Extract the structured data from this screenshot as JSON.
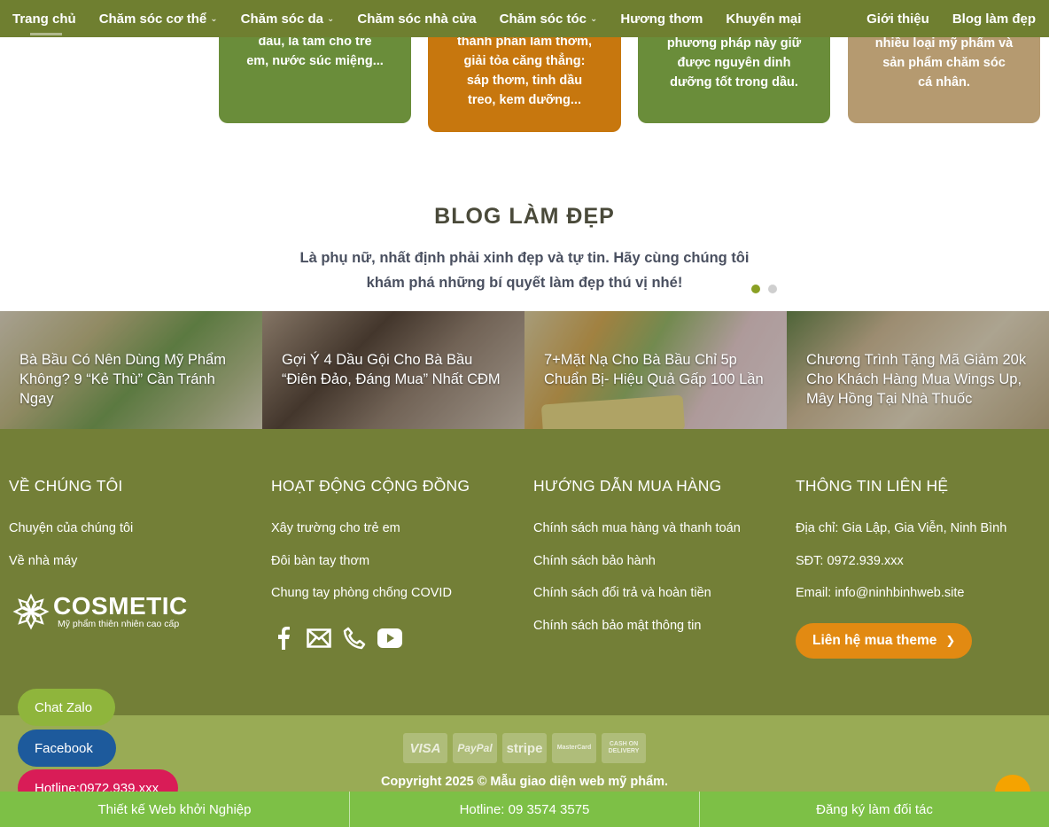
{
  "nav": {
    "items": [
      {
        "label": "Trang chủ",
        "dropdown": false,
        "active": true
      },
      {
        "label": "Chăm sóc cơ thể",
        "dropdown": true
      },
      {
        "label": "Chăm sóc da",
        "dropdown": true
      },
      {
        "label": "Chăm sóc nhà cửa",
        "dropdown": false
      },
      {
        "label": "Chăm sóc tóc",
        "dropdown": true
      },
      {
        "label": "Hương thơm",
        "dropdown": false
      },
      {
        "label": "Khuyến mại",
        "dropdown": false
      }
    ],
    "right_items": [
      {
        "label": "Giới thiệu"
      },
      {
        "label": "Blog làm đẹp"
      }
    ],
    "chevron": "⌄"
  },
  "cards": [
    {
      "lines": [
        "đầu, lá tắm cho trẻ",
        "em, nước súc miệng..."
      ],
      "color": "#6a8d3a"
    },
    {
      "lines": [
        "thành phần làm thơm,",
        "giải tỏa căng thẳng:",
        "sáp thơm, tinh dầu",
        "treo, kem dưỡng..."
      ],
      "color": "#c7770e"
    },
    {
      "lines": [
        "phương pháp này giữ",
        "được nguyên dinh",
        "dưỡng tốt trong dầu."
      ],
      "color": "#6a8d3a"
    },
    {
      "lines": [
        "nhiều loại mỹ phẩm và",
        "sản phẩm chăm sóc",
        "cá nhân."
      ],
      "color": "#b59a70"
    }
  ],
  "blog": {
    "title": "BLOG LÀM ĐẸP",
    "subtitle_line1": "Là phụ nữ, nhất định phải xinh đẹp và tự tin. Hãy cùng chúng tôi",
    "subtitle_line2": "khám phá những bí quyết làm đẹp thú vị nhé!",
    "posts": [
      {
        "title": "Bà Bầu Có Nên Dùng Mỹ Phẩm Không? 9 “Kẻ Thù” Cần Tránh Ngay"
      },
      {
        "title": "Gợi Ý 4 Dầu Gội Cho Bà Bầu “Điên Đảo, Đáng Mua” Nhất CĐM"
      },
      {
        "title": "7+Mặt Nạ Cho Bà Bầu Chỉ 5p Chuẩn Bị- Hiệu Quả Gấp 100 Lần"
      },
      {
        "title": "Chương Trình Tặng Mã Giảm 20k Cho Khách Hàng Mua Wings Up, Mây Hồng Tại Nhà Thuốc"
      }
    ]
  },
  "footer": {
    "col1": {
      "heading": "VỀ CHÚNG TÔI",
      "links": [
        "Chuyện của chúng tôi",
        "Về nhà máy"
      ]
    },
    "col2": {
      "heading": "HOẠT ĐỘNG CỘNG ĐỒNG",
      "links": [
        "Xây trường cho trẻ em",
        "Đôi bàn tay thơm",
        "Chung tay phòng chống COVID"
      ]
    },
    "col3": {
      "heading": "HƯỚNG DẪN MUA HÀNG",
      "links": [
        "Chính sách mua hàng và thanh toán",
        "Chính sách bảo hành",
        "Chính sách đổi trả và hoàn tiền",
        "Chính sách bảo mật thông tin"
      ]
    },
    "col4": {
      "heading": "THÔNG TIN LIÊN HỆ",
      "address": "Địa chỉ: Gia Lập, Gia Viễn, Ninh Bình",
      "phone": "SĐT: 0972.939.xxx",
      "email": "Email: info@ninhbinhweb.site",
      "cta": "Liên hệ mua theme"
    },
    "logo": {
      "word": "COSMETIC",
      "tagline": "Mỹ phẩm thiên nhiên cao cấp"
    },
    "social_icons": [
      "facebook-icon",
      "mail-icon",
      "phone-icon",
      "youtube-icon"
    ],
    "payments": [
      "VISA",
      "PayPal",
      "stripe",
      "MasterCard",
      "CASH ON DELIVERY"
    ],
    "copyright": "Copyright 2025 © Mẫu giao diện web mỹ phẩm."
  },
  "floating": {
    "zalo": "Chat Zalo",
    "facebook": "Facebook",
    "hotline": "Hotline:0972.939.xxx"
  },
  "bottom_bar": [
    "Thiết kế Web khởi Nghiệp",
    "Hotline: 09 3574 3575",
    "Đăng ký làm đối tác"
  ],
  "colors": {
    "nav_bg": "#6f7f30",
    "footer_bg": "#737f37",
    "footer2_bg": "#99ab55",
    "cta": "#e28a12",
    "bottom_bar": "#7dc046",
    "dot_active": "#8aa024"
  }
}
